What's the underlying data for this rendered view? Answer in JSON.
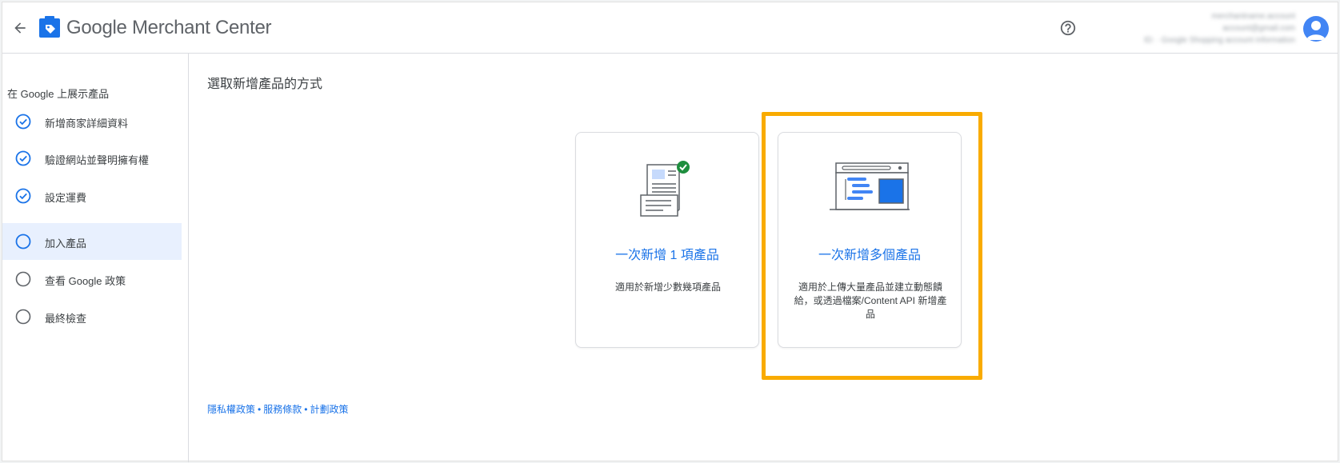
{
  "header": {
    "brand_google": "Google",
    "brand_product": "Merchant Center",
    "back_icon": "arrow-back-icon",
    "help_icon": "help-circle-icon",
    "account_lines": [
      "merchantname.account",
      "account@gmail.com",
      "ID: · Google Shopping account information"
    ]
  },
  "sidebar": {
    "title": "在 Google 上展示產品",
    "steps": [
      {
        "label": "新增商家詳細資料",
        "status": "complete"
      },
      {
        "label": "驗證網站並聲明擁有權",
        "status": "complete"
      },
      {
        "label": "設定運費",
        "status": "complete"
      },
      {
        "label": "加入產品",
        "status": "current"
      },
      {
        "label": "查看 Google 政策",
        "status": "incomplete"
      },
      {
        "label": "最終檢查",
        "status": "incomplete"
      }
    ]
  },
  "main": {
    "title": "選取新增產品的方式",
    "cards": [
      {
        "title": "一次新增 1 項產品",
        "description": "適用於新增少數幾項產品",
        "icon": "single-product-document-icon"
      },
      {
        "title": "一次新增多個產品",
        "description": "適用於上傳大量產品並建立動態饋給，或透過檔案/Content API 新增產品",
        "icon": "multiple-products-feed-icon"
      }
    ]
  },
  "footer": {
    "links": [
      "隱私權政策",
      "服務條款",
      "計劃政策"
    ],
    "separator": "•"
  },
  "colors": {
    "accent": "#1a73e8",
    "highlight": "#f9ab00",
    "active_step_bg": "#e8f0fe",
    "check_green": "#1e8e3e"
  }
}
